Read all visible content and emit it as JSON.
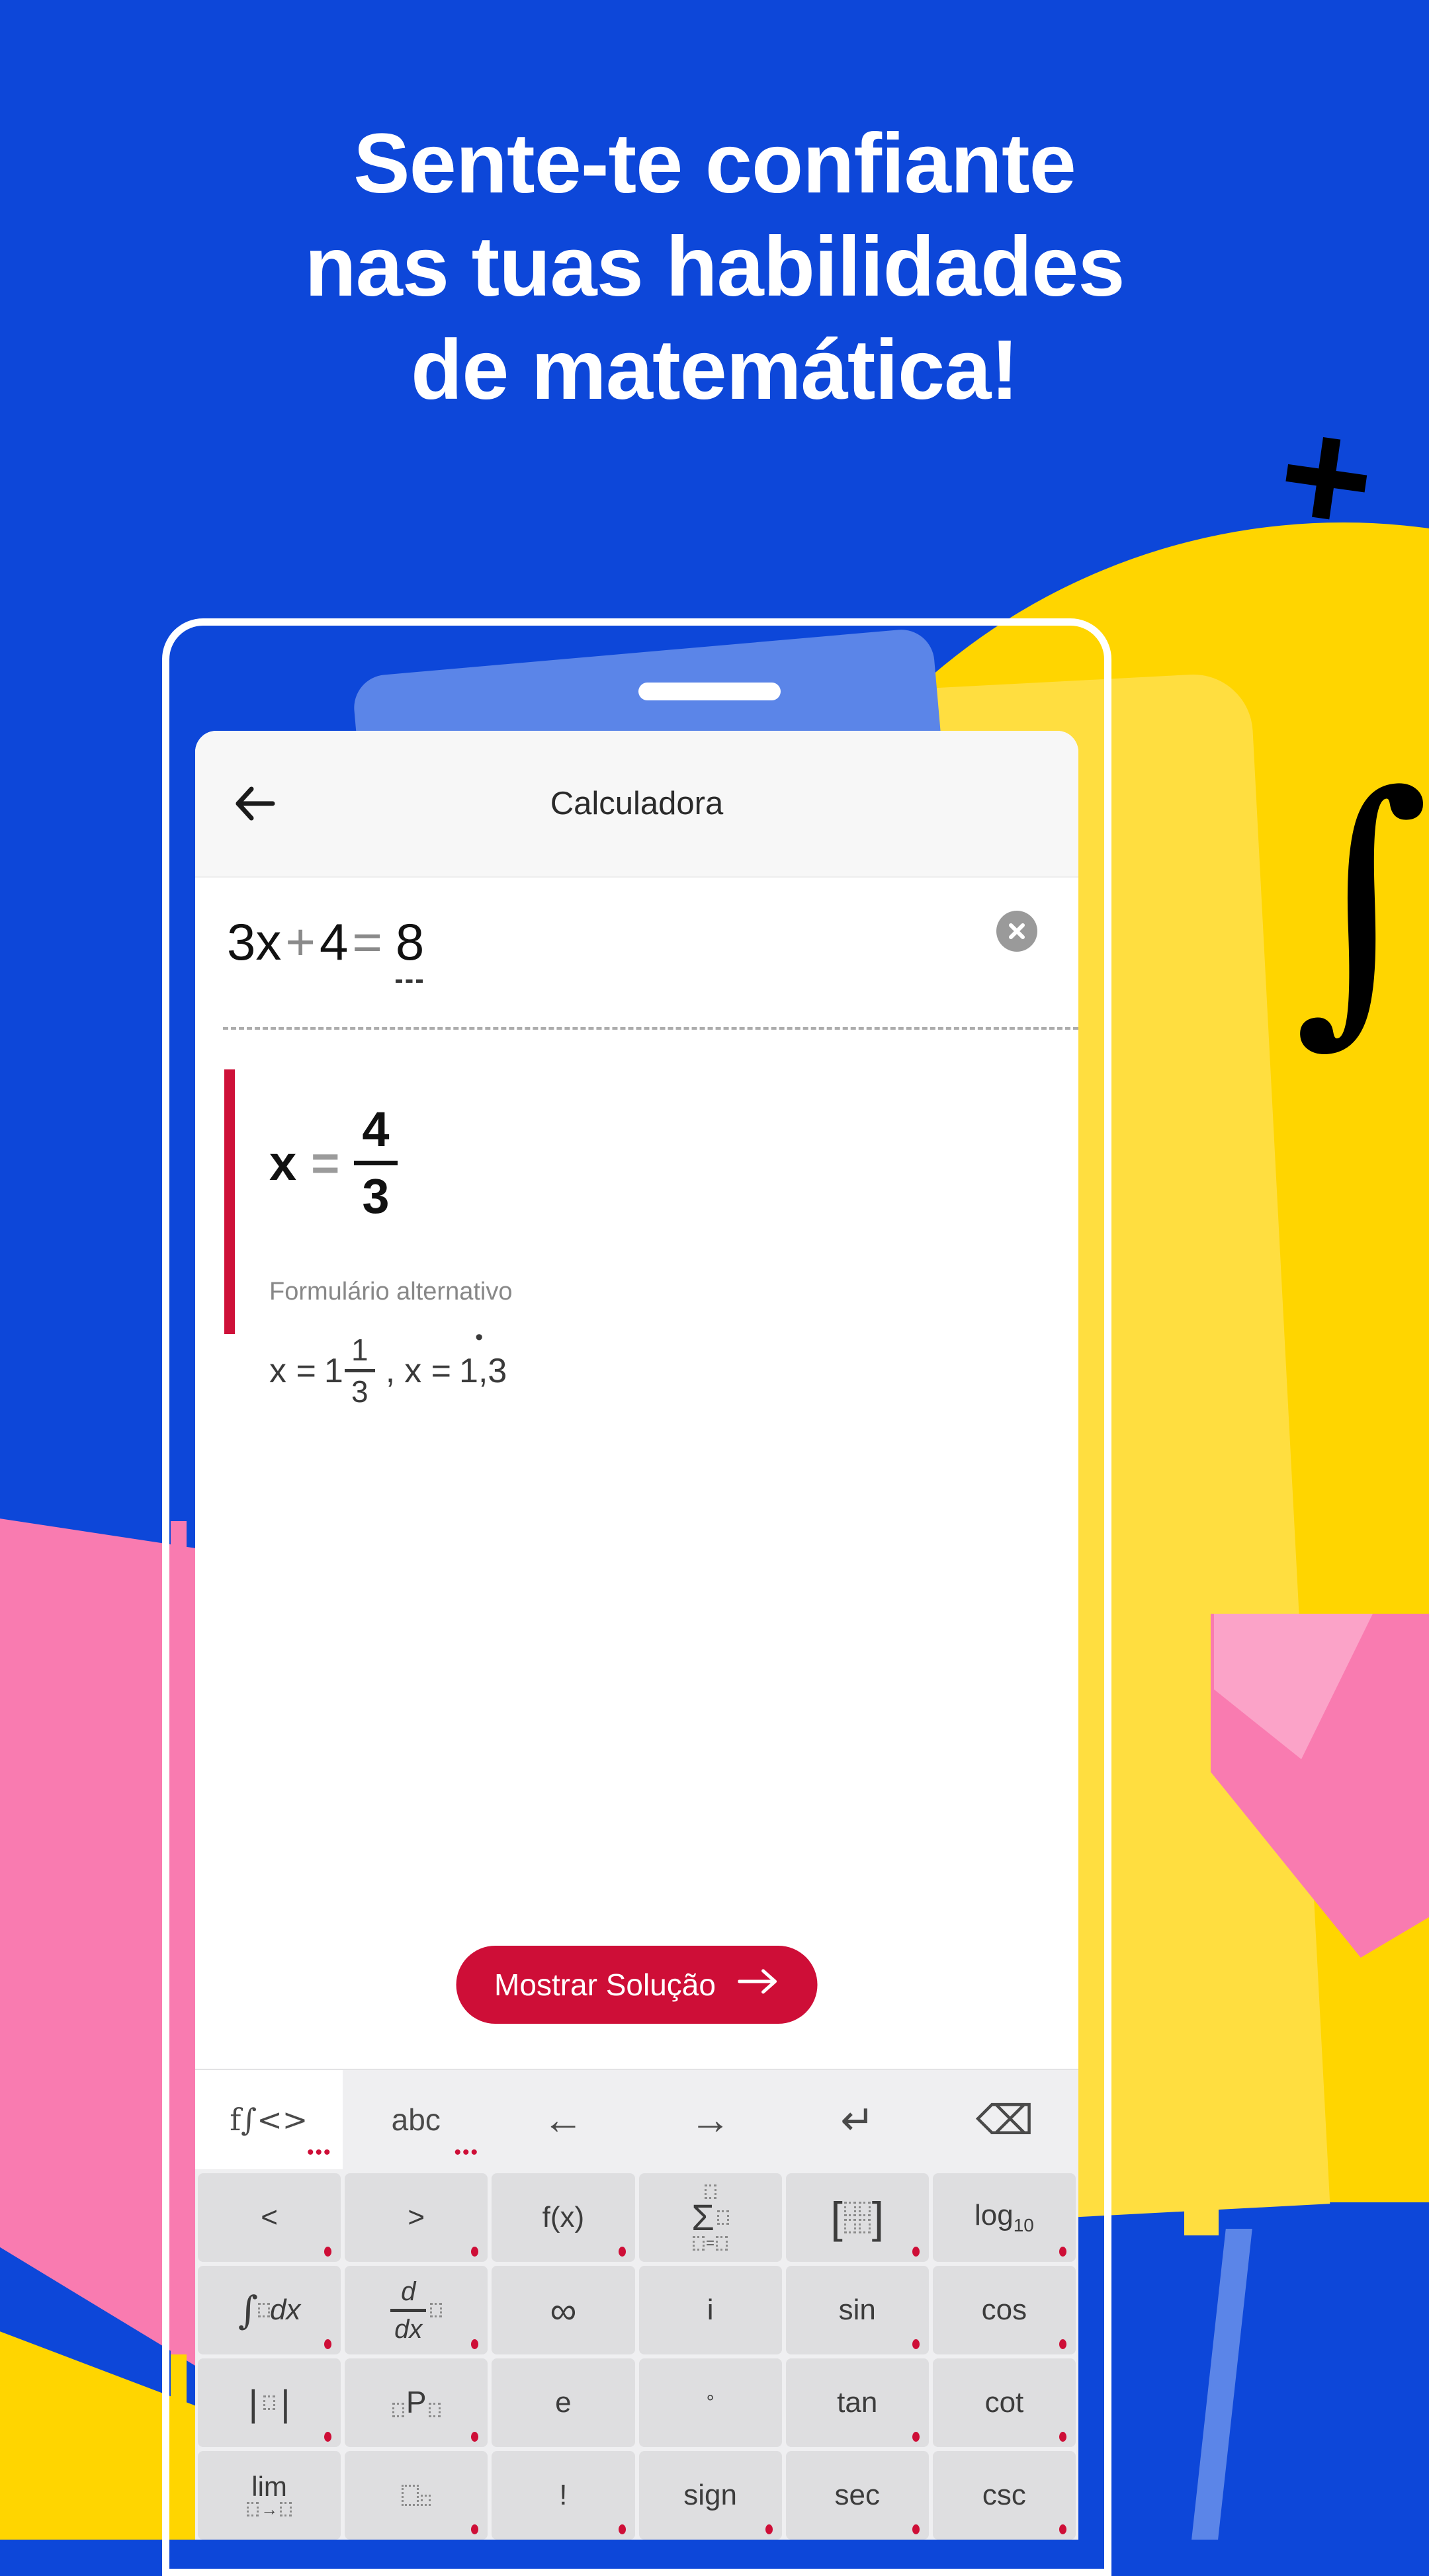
{
  "headline": {
    "line1": "Sente-te confiante",
    "line2": "nas tuas habilidades",
    "line3": "de matemática!"
  },
  "decor": {
    "plus": "+",
    "integral": "∫"
  },
  "colors": {
    "background_blue": "#0D47D9",
    "yellow": "#FFD500",
    "pink": "#F97BB0",
    "accent_red": "#CE0E37",
    "light_blue": "#5B85E8"
  },
  "app": {
    "appbar": {
      "back_icon": "back-arrow-icon",
      "title": "Calculadora"
    },
    "expression": {
      "terms": [
        "3x",
        "+",
        "4",
        "=",
        "8"
      ],
      "cursor_on": "8",
      "clear_icon": "clear-circle-x-icon"
    },
    "result": {
      "variable": "x",
      "equals": "=",
      "numerator": "4",
      "denominator": "3",
      "alt_label": "Formulário alternativo",
      "alt_form_1": {
        "lhs": "x =",
        "whole": "1",
        "numerator": "1",
        "denominator": "3"
      },
      "separator": ",",
      "alt_form_2": {
        "lhs": "x =",
        "value": "1,3",
        "repeating_digit": "3"
      }
    },
    "solve_button": {
      "label": "Mostrar Solução",
      "arrow_icon": "arrow-right-icon"
    },
    "keyboard": {
      "toolbar": [
        {
          "label": "f∫<>",
          "name": "tab-math",
          "active": true,
          "has_dots": true
        },
        {
          "label": "abc",
          "name": "tab-abc",
          "active": false,
          "has_dots": true
        },
        {
          "label": "←",
          "name": "cursor-left-icon",
          "active": false,
          "has_dots": false
        },
        {
          "label": "→",
          "name": "cursor-right-icon",
          "active": false,
          "has_dots": false
        },
        {
          "label": "↵",
          "name": "enter-icon",
          "active": false,
          "has_dots": false
        },
        {
          "label": "⌫",
          "name": "backspace-icon",
          "active": false,
          "has_dots": false
        }
      ],
      "rows": [
        [
          {
            "name": "key-less-than",
            "label": "<",
            "dot": true
          },
          {
            "name": "key-greater-than",
            "label": ">",
            "dot": true
          },
          {
            "name": "key-function",
            "label": "f(x)",
            "dot": true
          },
          {
            "name": "key-summation",
            "label": "Σ",
            "dot": false
          },
          {
            "name": "key-matrix",
            "label": "[□□]",
            "dot": true
          },
          {
            "name": "key-log10",
            "label": "log10",
            "dot": true
          }
        ],
        [
          {
            "name": "key-integral",
            "label": "∫□dx",
            "dot": true
          },
          {
            "name": "key-derivative",
            "label": "d/dx□",
            "dot": true
          },
          {
            "name": "key-infinity",
            "label": "∞",
            "dot": false
          },
          {
            "name": "key-imaginary",
            "label": "i",
            "dot": false
          },
          {
            "name": "key-sin",
            "label": "sin",
            "dot": true
          },
          {
            "name": "key-cos",
            "label": "cos",
            "dot": true
          }
        ],
        [
          {
            "name": "key-absolute",
            "label": "|□|",
            "dot": true
          },
          {
            "name": "key-permutation",
            "label": "□P□",
            "dot": true
          },
          {
            "name": "key-euler",
            "label": "e",
            "dot": false
          },
          {
            "name": "key-degree",
            "label": "°",
            "dot": false
          },
          {
            "name": "key-tan",
            "label": "tan",
            "dot": true
          },
          {
            "name": "key-cot",
            "label": "cot",
            "dot": true
          }
        ],
        [
          {
            "name": "key-limit",
            "label": "lim □→□",
            "dot": false
          },
          {
            "name": "key-subscript",
            "label": "□_□",
            "dot": true
          },
          {
            "name": "key-factorial",
            "label": "!",
            "dot": true
          },
          {
            "name": "key-sign",
            "label": "sign",
            "dot": true
          },
          {
            "name": "key-sec",
            "label": "sec",
            "dot": true
          },
          {
            "name": "key-csc",
            "label": "csc",
            "dot": true
          }
        ]
      ]
    }
  }
}
